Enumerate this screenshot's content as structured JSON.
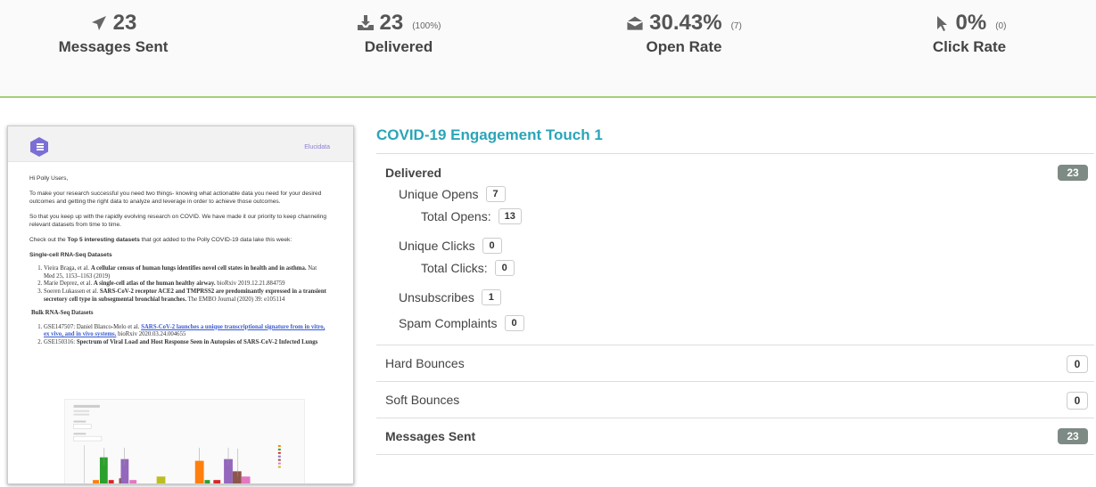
{
  "stats": {
    "sent": {
      "value": "23",
      "label": "Messages Sent",
      "icon": "paper-plane-icon"
    },
    "delivered": {
      "value": "23",
      "sub": "(100%)",
      "label": "Delivered",
      "icon": "inbox-download-icon"
    },
    "open": {
      "value": "30.43%",
      "sub": "(7)",
      "label": "Open Rate",
      "icon": "open-envelope-icon"
    },
    "click": {
      "value": "0%",
      "sub": "(0)",
      "label": "Click Rate",
      "icon": "cursor-icon"
    }
  },
  "preview": {
    "brand": "Elucidata",
    "greeting": "Hi Polly Users,",
    "para1": "To make your research successful you need two things- knowing what actionable data you need for your desired outcomes and getting the right data to analyze and leverage in order to achieve those outcomes.",
    "para2": "So that you keep up with the rapidly evolving research on COVID. We have made it our priority to keep channeling relevant datasets from time to time.",
    "para3_pre": "Check out the ",
    "para3_bold": "Top 5 interesting datasets",
    "para3_post": " that got added to the Polly COVID-19 data lake this week:",
    "section1": "Single-cell RNA-Seq Datasets",
    "s1_items": [
      {
        "pre": "Vieira Braga, et al. ",
        "bold": "A cellular census of human lungs identifies novel cell states in health and in asthma.",
        "post": " Nat Med 25, 1153–1163 (2019)"
      },
      {
        "pre": "Marie Deprez, et al. ",
        "bold": "A single-cell atlas of the human healthy airway.",
        "post": " bioRxiv 2019.12.21.884759"
      },
      {
        "pre": "Soeren Lukassen et al. ",
        "bold": "SARS-CoV-2 receptor ACE2 and TMPRSS2 are predominantly expressed in a transient secretory cell type in subsegmental bronchial branches.",
        "post": " The EMBO Journal (2020) 39: e105114"
      }
    ],
    "section2": "Bulk RNA-Seq Datasets",
    "s2_items": [
      {
        "pre": "GSE147507: Daniel Blanco-Melo et al. ",
        "link": "SARS-CoV-2 launches a unique transcriptional signature from in vitro, ex vivo, and in vivo systems.",
        "post": " bioRxiv 2020.03.24.004655"
      },
      {
        "pre": "GSE150316: ",
        "bold": "Spectrum of Viral Load and Host Response Seen in Autopsies of SARS-CoV-2 Infected Lungs",
        "post": ""
      }
    ]
  },
  "campaign": {
    "title": "COVID-19 Engagement Touch 1",
    "delivered_label": "Delivered",
    "delivered_count": "23",
    "unique_opens_label": "Unique Opens",
    "unique_opens": "7",
    "total_opens_label": "Total Opens:",
    "total_opens": "13",
    "unique_clicks_label": "Unique Clicks",
    "unique_clicks": "0",
    "total_clicks_label": "Total Clicks:",
    "total_clicks": "0",
    "unsub_label": "Unsubscribes",
    "unsub": "1",
    "spam_label": "Spam Complaints",
    "spam": "0",
    "hard_label": "Hard Bounces",
    "hard": "0",
    "soft_label": "Soft Bounces",
    "soft": "0",
    "sent_label": "Messages Sent",
    "sent": "23"
  },
  "colors": {
    "accent_teal": "#2aa5b8",
    "header_rule": "#a6cf7a",
    "badge_dark": "#7e8a84",
    "logo_purple": "#7b6fd6"
  }
}
